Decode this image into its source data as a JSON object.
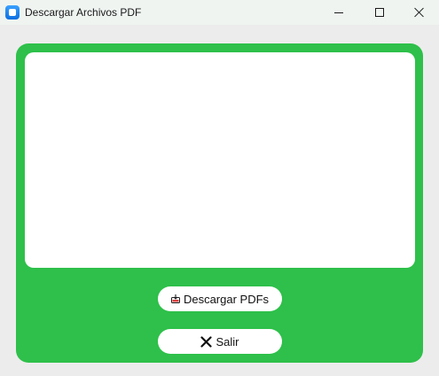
{
  "window": {
    "title": "Descargar Archivos PDF",
    "icon": "app-window-icon"
  },
  "main": {
    "buttons": {
      "download_label": "Descargar PDFs",
      "download_icon": "inbox-download-icon",
      "exit_label": "Salir",
      "exit_icon": "close-x-icon"
    }
  },
  "colors": {
    "panel_green": "#2ec04a",
    "titlebar": "#eff4f1",
    "background": "#ececec"
  }
}
